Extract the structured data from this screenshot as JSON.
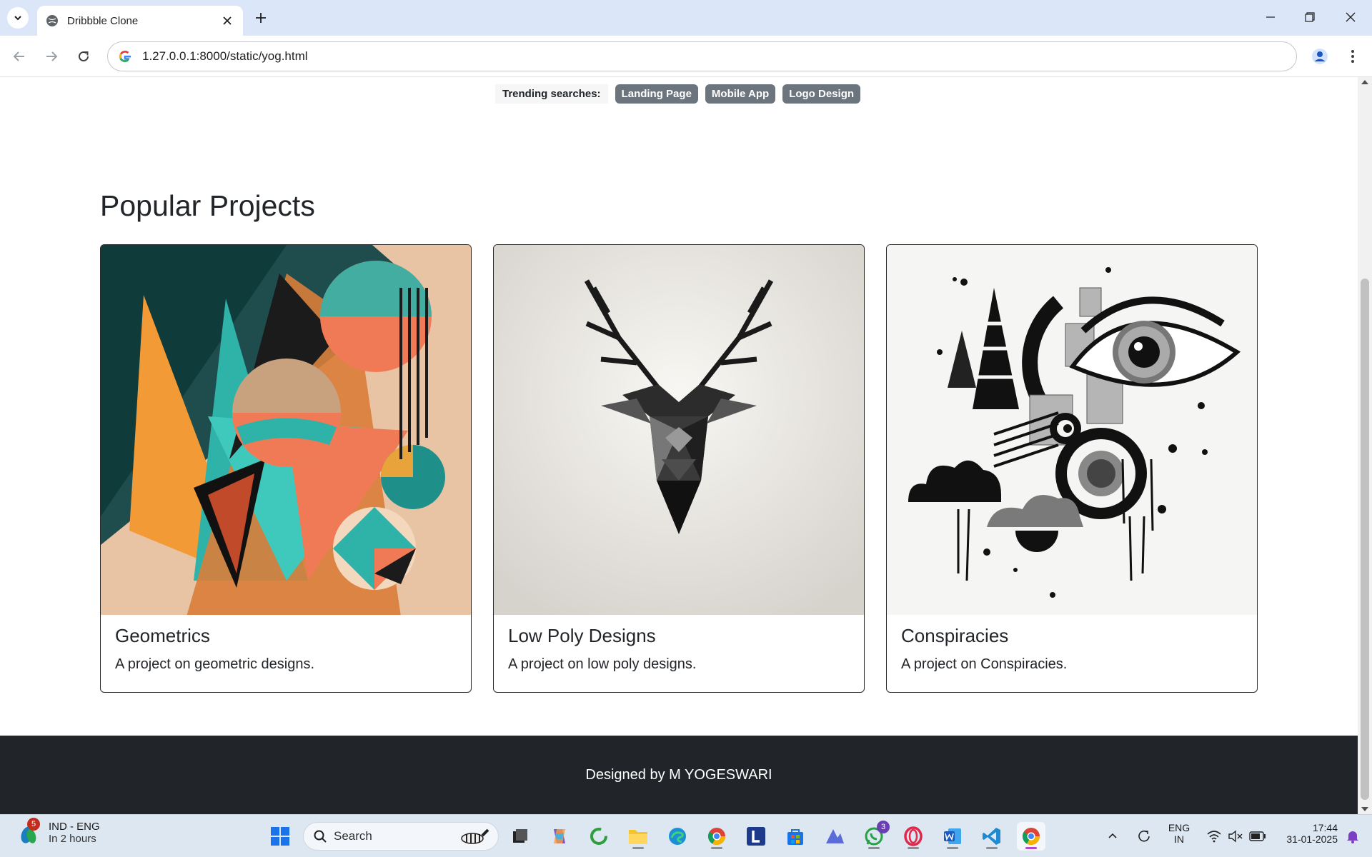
{
  "browser": {
    "tab_title": "Dribbble Clone",
    "url": "1.27.0.0.1:8000/static/yog.html"
  },
  "page": {
    "trending_label": "Trending searches:",
    "trending": [
      "Landing Page",
      "Mobile App",
      "Logo Design"
    ],
    "section_title": "Popular Projects",
    "projects": [
      {
        "title": "Geometrics",
        "description": "A project on geometric designs."
      },
      {
        "title": "Low Poly Designs",
        "description": "A project on low poly designs."
      },
      {
        "title": "Conspiracies",
        "description": "A project on Conspiracies."
      }
    ],
    "footer": "Designed by M YOGESWARI"
  },
  "taskbar": {
    "weather_line1": "IND - ENG",
    "weather_line2": "In 2 hours",
    "weather_badge": "5",
    "search_placeholder": "Search",
    "whatsapp_badge": "3",
    "lang_line1": "ENG",
    "lang_line2": "IN",
    "time": "17:44",
    "date": "31-01-2025"
  },
  "colors": {
    "titlebar": "#dbe6f8",
    "pill": "#6c757d",
    "footer": "#212529",
    "taskbar": "#dde7f2"
  }
}
